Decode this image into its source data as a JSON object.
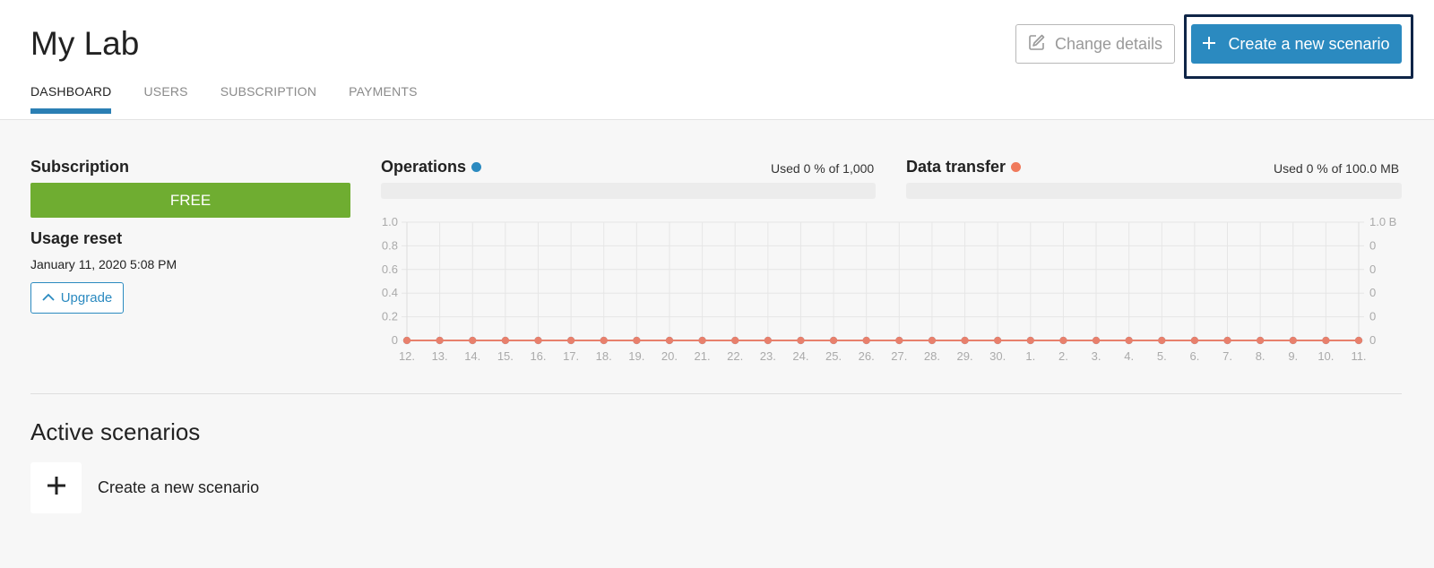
{
  "header": {
    "title": "My Lab",
    "tabs": [
      {
        "label": "DASHBOARD",
        "active": true
      },
      {
        "label": "USERS",
        "active": false
      },
      {
        "label": "SUBSCRIPTION",
        "active": false
      },
      {
        "label": "PAYMENTS",
        "active": false
      }
    ],
    "change_details_label": "Change details",
    "create_scenario_label": "Create a new scenario"
  },
  "subscription": {
    "label": "Subscription",
    "plan": "FREE",
    "usage_reset_label": "Usage reset",
    "usage_reset_date": "January 11, 2020 5:08 PM",
    "upgrade_label": "Upgrade"
  },
  "operations": {
    "label": "Operations",
    "used_text": "Used 0 % of 1,000",
    "used_fraction": 0,
    "color": "#2b8ac0"
  },
  "data_transfer": {
    "label": "Data transfer",
    "used_text": "Used 0 % of 100.0 MB",
    "used_fraction": 0,
    "color": "#f07a5c"
  },
  "chart_data": {
    "type": "line",
    "x": [
      "12.",
      "13.",
      "14.",
      "15.",
      "16.",
      "17.",
      "18.",
      "19.",
      "20.",
      "21.",
      "22.",
      "23.",
      "24.",
      "25.",
      "26.",
      "27.",
      "28.",
      "29.",
      "30.",
      "1.",
      "2.",
      "3.",
      "4.",
      "5.",
      "6.",
      "7.",
      "8.",
      "9.",
      "10.",
      "11."
    ],
    "left_axis": {
      "ticks": [
        "1.0",
        "0.8",
        "0.6",
        "0.4",
        "0.2",
        "0"
      ],
      "ylim": [
        0,
        1
      ]
    },
    "right_axis": {
      "ticks": [
        "1.0 B",
        "0",
        "0",
        "0",
        "0",
        "0"
      ],
      "ylim": [
        0,
        1
      ]
    },
    "series": [
      {
        "values": [
          0,
          0,
          0,
          0,
          0,
          0,
          0,
          0,
          0,
          0,
          0,
          0,
          0,
          0,
          0,
          0,
          0,
          0,
          0,
          0,
          0,
          0,
          0,
          0,
          0,
          0,
          0,
          0,
          0,
          0
        ],
        "color": "#2b8ac0"
      },
      {
        "values": [
          0,
          0,
          0,
          0,
          0,
          0,
          0,
          0,
          0,
          0,
          0,
          0,
          0,
          0,
          0,
          0,
          0,
          0,
          0,
          0,
          0,
          0,
          0,
          0,
          0,
          0,
          0,
          0,
          0,
          0
        ],
        "color": "#e8806c"
      }
    ],
    "grid": true
  },
  "active_scenarios": {
    "title": "Active scenarios",
    "create_label": "Create a new scenario"
  }
}
